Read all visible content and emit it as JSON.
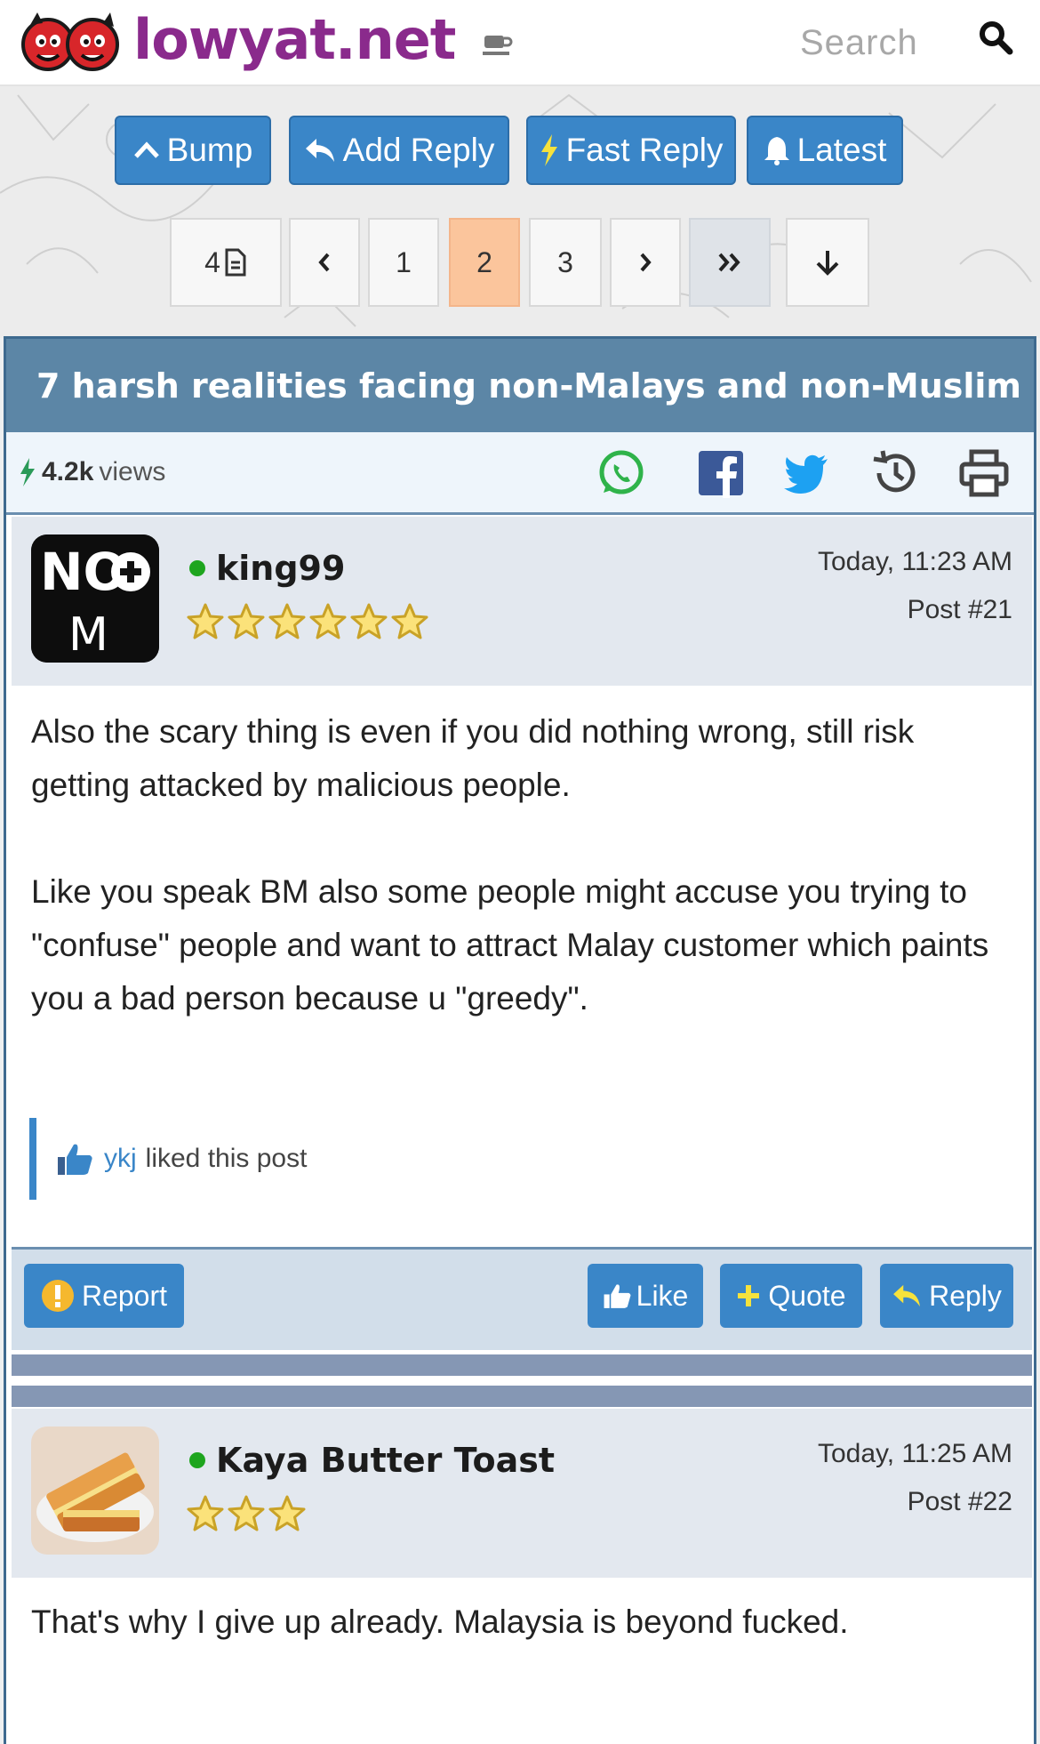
{
  "header": {
    "logo_text": "lowyat.net",
    "search_placeholder": "Search"
  },
  "actions": {
    "bump": "Bump",
    "add_reply": "Add Reply",
    "fast_reply": "Fast Reply",
    "latest": "Latest"
  },
  "pagination": {
    "total_pages": "4",
    "pages": [
      "1",
      "2",
      "3"
    ],
    "current_page": "2"
  },
  "topic": {
    "title": "7 harsh realities facing non-Malays and non-Muslim",
    "views_count": "4.2k",
    "views_label": "views"
  },
  "posts": [
    {
      "username": "king99",
      "rating": 6,
      "time": "Today, 11:23 AM",
      "post_number": "Post #21",
      "body": [
        "Also the scary thing is even if you did nothing wrong, still risk getting attacked by malicious people.",
        "Like you speak BM also some people might accuse you trying to \"confuse\" people and want to attract Malay customer which paints you a bad person because u \"greedy\"."
      ],
      "liked_by": "ykj",
      "liked_text": "liked this post",
      "avatar_top": "NO",
      "avatar_bottom": "M"
    },
    {
      "username": "Kaya Butter Toast",
      "rating": 3,
      "time": "Today, 11:25 AM",
      "post_number": "Post #22",
      "body": [
        "That's why I give up already. Malaysia is beyond fucked."
      ]
    }
  ],
  "post_actions": {
    "report": "Report",
    "like": "Like",
    "quote": "Quote",
    "reply": "Reply"
  },
  "colors": {
    "button_blue": "#3a86c8",
    "title_bar": "#5c86a6",
    "active_page": "#fbc59c",
    "logo_purple": "#8a2a8c",
    "online_green": "#1ea51e"
  }
}
